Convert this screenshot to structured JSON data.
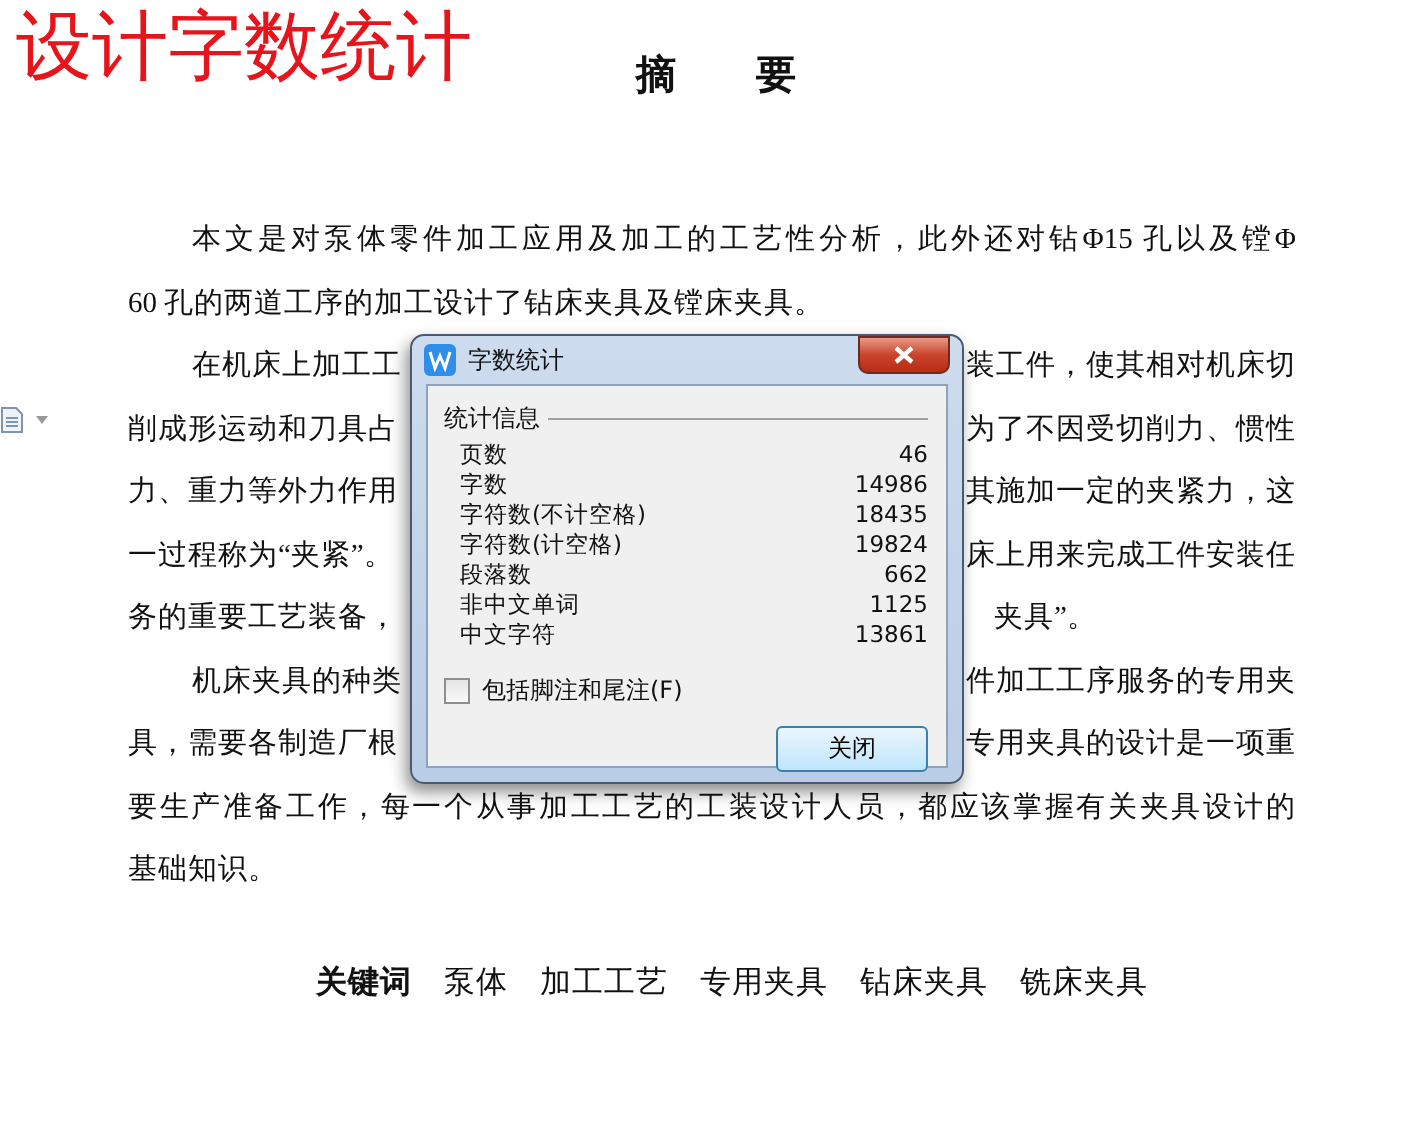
{
  "annotation_title": "设计字数统计",
  "document": {
    "heading": "摘　　要",
    "paragraphs": [
      {
        "lines": [
          {
            "text": "本文是对泵体零件加工应用及加工的工艺性分析，此外还对钻Φ15 孔以及镗Φ"
          },
          {
            "text": "60 孔的两道工序的加工设计了钻床夹具及镗床夹具。"
          }
        ]
      },
      {
        "lines": [
          {
            "text": "在机床上加工工",
            "right": "装工件，使其相对机床切"
          },
          {
            "text": "削成形运动和刀具占",
            "right": "为了不因受切削力、惯性"
          },
          {
            "text": "力、重力等外力作用",
            "right": "其施加一定的夹紧力，这"
          },
          {
            "text": "一过程称为“夹紧”。",
            "right": "床上用来完成工件安装任"
          },
          {
            "text": "务的重要工艺装备，",
            "right": "夹具”。"
          }
        ]
      },
      {
        "lines": [
          {
            "text": "机床夹具的种类",
            "right": "件加工工序服务的专用夹"
          },
          {
            "text": "具，需要各制造厂根",
            "right": "专用夹具的设计是一项重"
          },
          {
            "text": "要生产准备工作，每一个从事加工工艺的工装设计人员，都应该掌握有关夹具设计的"
          },
          {
            "text": "基础知识。"
          }
        ]
      }
    ],
    "keywords": {
      "label": "关键词",
      "terms": [
        "泵体",
        "加工工艺",
        "专用夹具",
        "钻床夹具",
        "铣床夹具"
      ]
    }
  },
  "dialog": {
    "title": "字数统计",
    "group": "统计信息",
    "stats": [
      {
        "label": "页数",
        "value": "46"
      },
      {
        "label": "字数",
        "value": "14986"
      },
      {
        "label": "字符数(不计空格)",
        "value": "18435"
      },
      {
        "label": "字符数(计空格)",
        "value": "19824"
      },
      {
        "label": "段落数",
        "value": "662"
      },
      {
        "label": "非中文单词",
        "value": "1125"
      },
      {
        "label": "中文字符",
        "value": "13861"
      }
    ],
    "checkbox": {
      "label": "包括脚注和尾注(F)",
      "checked": false
    },
    "button": "关闭"
  }
}
